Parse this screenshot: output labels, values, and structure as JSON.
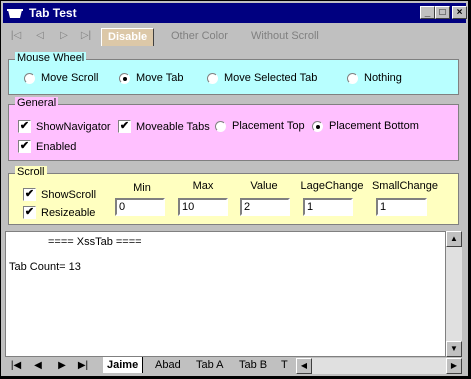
{
  "window": {
    "title": "Tab Test",
    "min": "_",
    "max": "□",
    "close": "×"
  },
  "toptabs": {
    "nav": [
      "|◁",
      "◁",
      "▷",
      "▷|"
    ],
    "tabs": [
      "Disable",
      "Other Color",
      "Without Scroll"
    ]
  },
  "mousewheel": {
    "title": "Mouse Wheel",
    "options": [
      "Move Scroll",
      "Move Tab",
      "Move Selected Tab",
      "Nothing"
    ],
    "selected": "Move Tab",
    "bg": "#b8ffff"
  },
  "general": {
    "title": "General",
    "show_navigator": "ShowNavigator",
    "moveable_tabs": "Moveable Tabs",
    "placement_top": "Placement Top",
    "placement_bottom": "Placement Bottom",
    "enabled": "Enabled",
    "bg": "#ffc0ff"
  },
  "scroll": {
    "title": "Scroll",
    "show_scroll": "ShowScroll",
    "resizeable": "Resizeable",
    "headers": [
      "Min",
      "Max",
      "Value",
      "LageChange",
      "SmallChange"
    ],
    "values": [
      "0",
      "10",
      "2",
      "1",
      "1"
    ],
    "bg": "#ffffc0"
  },
  "output": {
    "line1": "==== XssTab ====",
    "line2": "Tab Count= 13"
  },
  "bottomtabs": {
    "nav": [
      "|◀",
      "◀",
      "▶",
      "▶|"
    ],
    "tabs": [
      "Jaime",
      "Abad",
      "Tab A",
      "Tab B",
      "T"
    ]
  },
  "icons": {
    "check": "✔",
    "up": "▲",
    "down": "▼",
    "left": "◀",
    "right": "▶"
  }
}
